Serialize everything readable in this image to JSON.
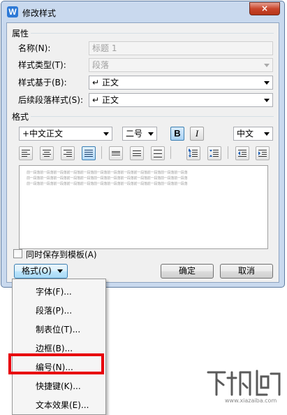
{
  "dialog": {
    "title": "修改样式",
    "app_icon_letter": "W",
    "close_glyph": "×"
  },
  "properties": {
    "section_label": "属性",
    "name_label": "名称(N):",
    "name_value": "标题 1",
    "style_type_label": "样式类型(T):",
    "style_type_value": "段落",
    "based_on_label": "样式基于(B):",
    "based_on_value": "正文",
    "following_label": "后续段落样式(S):",
    "following_value": "正文",
    "para_mark": "↵"
  },
  "format": {
    "section_label": "格式",
    "font_value": "+中文正文",
    "size_value": "二号",
    "bold_label": "B",
    "italic_label": "I",
    "script_value": "中文",
    "bold_pressed": true,
    "toolbar_icons": [
      "align-left-icon",
      "align-center-icon",
      "align-right-icon",
      "justify-icon",
      "line-spacing-single-icon",
      "line-spacing-1-5-icon",
      "line-spacing-double-icon",
      "increase-paragraph-spacing-icon",
      "decrease-paragraph-spacing-icon",
      "decrease-indent-icon",
      "increase-indent-icon"
    ],
    "active_alignment": "justify-icon"
  },
  "preview": {
    "lines": [
      "前一段落前一段落前一段落前一段落前一段落前一段落前一段落前一段落前一段落前一段落前一段落前一段落",
      "前一段落前一段落前一段落前一段落前一段落前一段落前一段落前一段落前一段落前一段落前一段落前一段落",
      "前一段落前一段落前一段落前一段落前一段落前一段落前一段落前一段落前一段落前一段落前一段落前一段落"
    ]
  },
  "footer": {
    "save_template_label": "同时保存到模板(A)",
    "save_template_checked": false,
    "format_button_label": "格式(O)",
    "ok_label": "确定",
    "cancel_label": "取消"
  },
  "format_menu": {
    "items": [
      "字体(F)...",
      "段落(P)...",
      "制表位(T)...",
      "边框(B)...",
      "编号(N)...",
      "快捷键(K)...",
      "文本效果(E)..."
    ],
    "highlighted_index": 4,
    "highlight_color": "#e8000b"
  },
  "watermark": {
    "text": "下载吧",
    "url": "www.xiazaiba.com"
  }
}
